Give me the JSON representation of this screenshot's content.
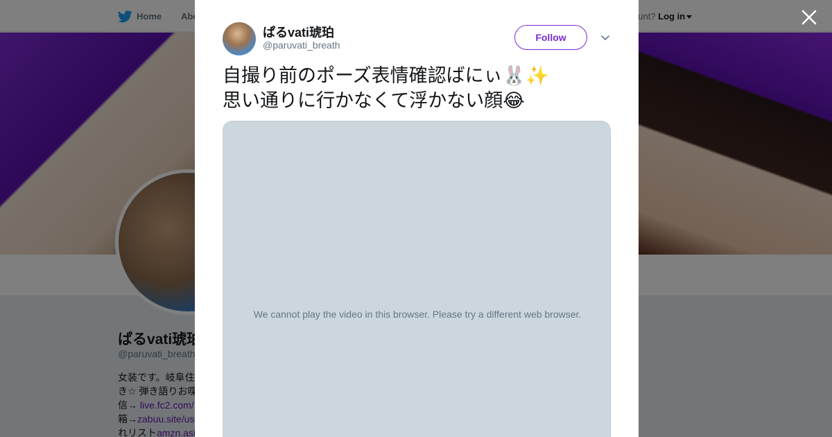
{
  "topbar": {
    "home_label": "Home",
    "about_label": "Abo",
    "account_prefix": "ccount?",
    "login_label": "Log in"
  },
  "profile": {
    "name": "ぱるvati琥珀",
    "handle": "@paruvati_breath",
    "bio_lines": [
      "女装です。岐阜住",
      "き☆ 弾き語りお喋",
      "信→ ",
      "箱→",
      "れリスト"
    ],
    "bio_links": [
      "live.fc2.com/",
      "zabuu.site/us",
      "amzn.asi"
    ]
  },
  "modal": {
    "user_name": "ぱるvati琥珀",
    "user_handle": "@paruvati_breath",
    "follow_label": "Follow",
    "tweet_line1": "自撮り前のポーズ表情確認ばにぃ🐰✨",
    "tweet_line2": "思い通りに行かなくて浮かない顔😂",
    "video_message": "We cannot play the video in this browser. Please try a different web browser."
  },
  "icons": {
    "brand": "twitter-bird-icon",
    "close": "close-icon",
    "chevron": "chevron-down-icon"
  },
  "colors": {
    "accent": "#7b2bd1",
    "twitter_blue": "#1da1f2"
  }
}
